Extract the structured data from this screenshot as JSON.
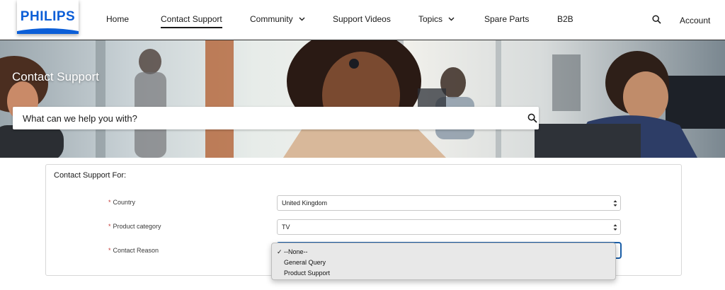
{
  "brand": {
    "logo_text": "PHILIPS",
    "color": "#0b5ed7"
  },
  "nav": {
    "items": [
      {
        "label": "Home"
      },
      {
        "label": "Contact Support",
        "active": true
      },
      {
        "label": "Community",
        "has_dropdown": true
      },
      {
        "label": "Support Videos"
      },
      {
        "label": "Topics",
        "has_dropdown": true
      },
      {
        "label": "Spare Parts"
      },
      {
        "label": "B2B"
      }
    ],
    "search_icon": "search-icon",
    "account_label": "Account"
  },
  "hero": {
    "title": "Contact Support",
    "search_placeholder": "What can we help you with?"
  },
  "form": {
    "title": "Contact Support For:",
    "required_marker": "*",
    "fields": [
      {
        "label": "Country",
        "value": "United Kingdom",
        "required": true
      },
      {
        "label": "Product category",
        "value": "TV",
        "required": true
      },
      {
        "label": "Contact Reason",
        "value": "--None--",
        "required": true,
        "open": true
      }
    ],
    "contact_reason_options": [
      {
        "label": "--None--",
        "selected": true
      },
      {
        "label": "General Query",
        "selected": false
      },
      {
        "label": "Product Support",
        "selected": false
      }
    ],
    "check_mark": "✓",
    "required_color": "#c23934",
    "focus_color": "#1b5fa8"
  }
}
